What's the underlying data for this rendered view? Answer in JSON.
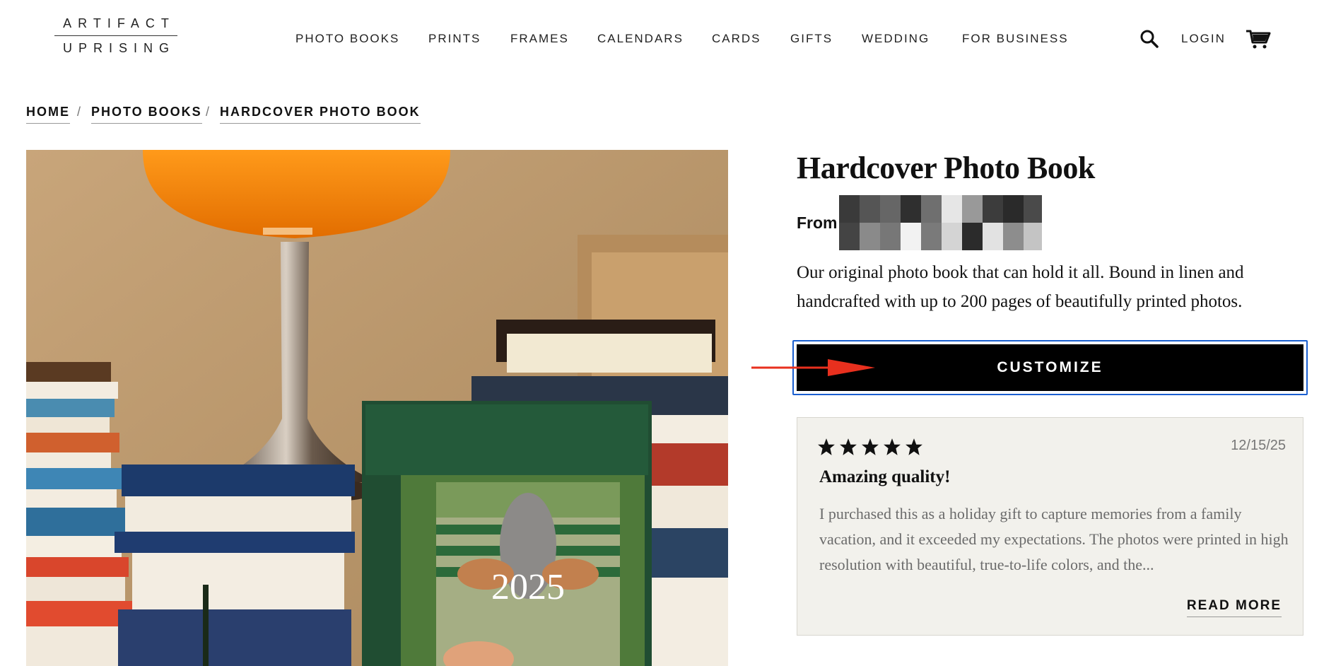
{
  "brand": {
    "line1": "ARTIFACT",
    "line2": "UPRISING"
  },
  "nav": {
    "items": [
      "PHOTO BOOKS",
      "PRINTS",
      "FRAMES",
      "CALENDARS",
      "CARDS",
      "GIFTS",
      "WEDDING",
      "FOR BUSINESS"
    ],
    "login": "LOGIN",
    "search_icon": "search-icon",
    "cart_icon": "cart-icon"
  },
  "breadcrumb": {
    "items": [
      "HOME",
      "PHOTO BOOKS",
      "HARDCOVER PHOTO BOOK"
    ],
    "separator": "/"
  },
  "hero": {
    "cover_year": "2025"
  },
  "product": {
    "title": "Hardcover Photo Book",
    "price_prefix": "From",
    "description": "Our original photo book that can hold it all. Bound in linen and handcrafted with up to 200 pages of beautifully printed photos.",
    "cta_label": "CUSTOMIZE"
  },
  "review": {
    "rating": 5,
    "max_rating": 5,
    "date": "12/15/25",
    "title": "Amazing quality!",
    "body": "I purchased this as a holiday gift to capture memories from a family vacation, and it exceeded my expectations. The photos were printed in high resolution with beautiful, true-to-life colors, and the...",
    "read_more": "READ MORE"
  },
  "colors": {
    "cta_background": "#000000",
    "focus_outline": "#1a5fd0",
    "annotation_arrow": "#e8301e",
    "review_background": "#f2f1ec"
  }
}
